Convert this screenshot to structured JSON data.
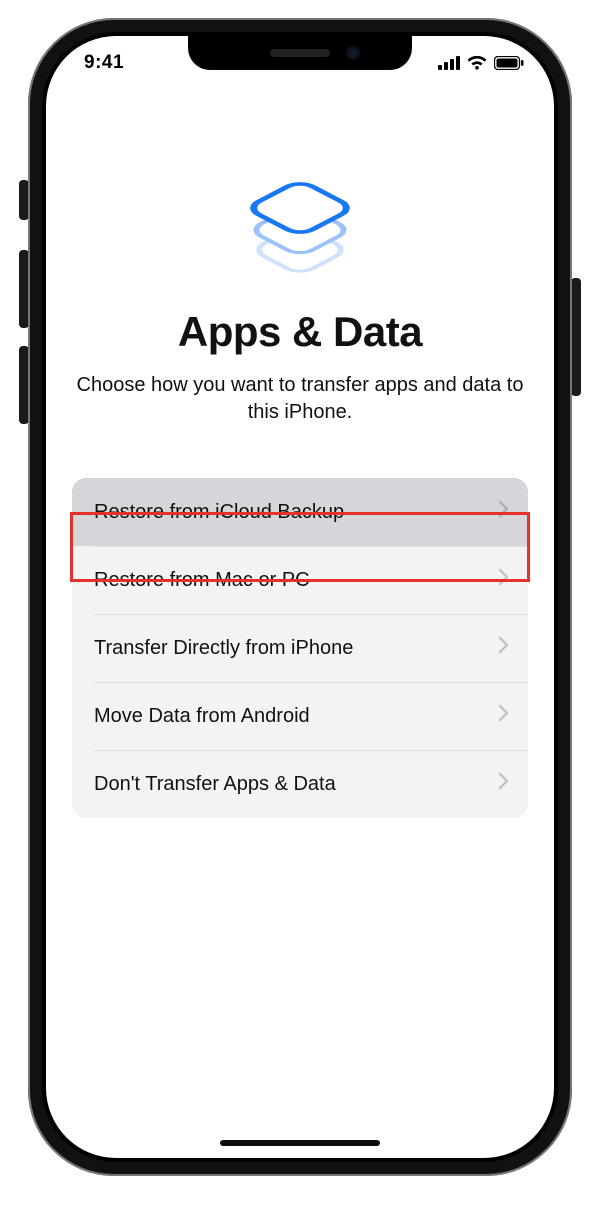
{
  "status": {
    "time": "9:41"
  },
  "page": {
    "title": "Apps & Data",
    "subtitle": "Choose how you want to transfer apps and data to this iPhone."
  },
  "options": [
    {
      "label": "Restore from iCloud Backup",
      "highlighted": true
    },
    {
      "label": "Restore from Mac or PC"
    },
    {
      "label": "Transfer Directly from iPhone"
    },
    {
      "label": "Move Data from Android"
    },
    {
      "label": "Don't Transfer Apps & Data"
    }
  ]
}
